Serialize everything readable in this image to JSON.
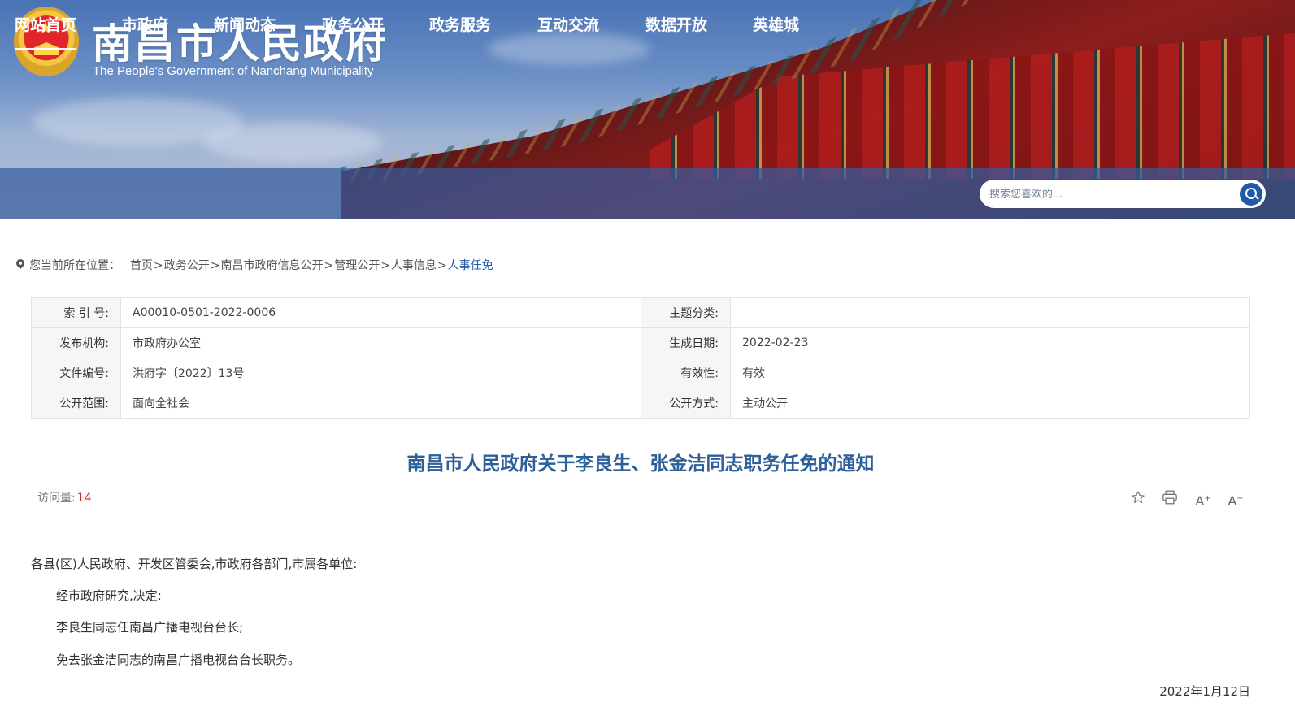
{
  "site": {
    "title": "南昌市人民政府",
    "subtitle": "The People's Government of Nanchang Municipality"
  },
  "nav": {
    "items": [
      "网站首页",
      "市政府",
      "新闻动态",
      "政务公开",
      "政务服务",
      "互动交流",
      "数据开放",
      "英雄城"
    ],
    "active_index": 0
  },
  "search": {
    "placeholder": "搜索您喜欢的..."
  },
  "breadcrumb": {
    "lead": "您当前所在位置：",
    "items": [
      "首页",
      "政务公开",
      "南昌市政府信息公开",
      "管理公开",
      "人事信息",
      "人事任免"
    ],
    "separator": ">"
  },
  "meta": {
    "rows": [
      {
        "label1": "索 引 号:",
        "value1": "A00010-0501-2022-0006",
        "label2": "主题分类:",
        "value2": ""
      },
      {
        "label1": "发布机构:",
        "value1": "市政府办公室",
        "label2": "生成日期:",
        "value2": "2022-02-23"
      },
      {
        "label1": "文件编号:",
        "value1": "洪府字〔2022〕13号",
        "label2": "有效性:",
        "value2": "有效"
      },
      {
        "label1": "公开范围:",
        "value1": "面向全社会",
        "label2": "公开方式:",
        "value2": "主动公开"
      }
    ]
  },
  "article": {
    "title": "南昌市人民政府关于李良生、张金洁同志职务任免的通知",
    "visits_label": "访问量:",
    "visits_count": "14",
    "tools": {
      "favorite": "star-icon",
      "print": "printer-icon",
      "font_larger": "A+",
      "font_smaller": "A-"
    },
    "salutation": "各县(区)人民政府、开发区管委会,市政府各部门,市属各单位:",
    "paragraphs": [
      "经市政府研究,决定:",
      "李良生同志任南昌广播电视台台长;",
      "免去张金洁同志的南昌广播电视台台长职务。"
    ],
    "date": "2022年1月12日"
  },
  "colors": {
    "nav_bg": "#345c9e",
    "title_blue": "#2d5f99",
    "link_blue": "#1f5aa8",
    "visits_red": "#b33333"
  }
}
